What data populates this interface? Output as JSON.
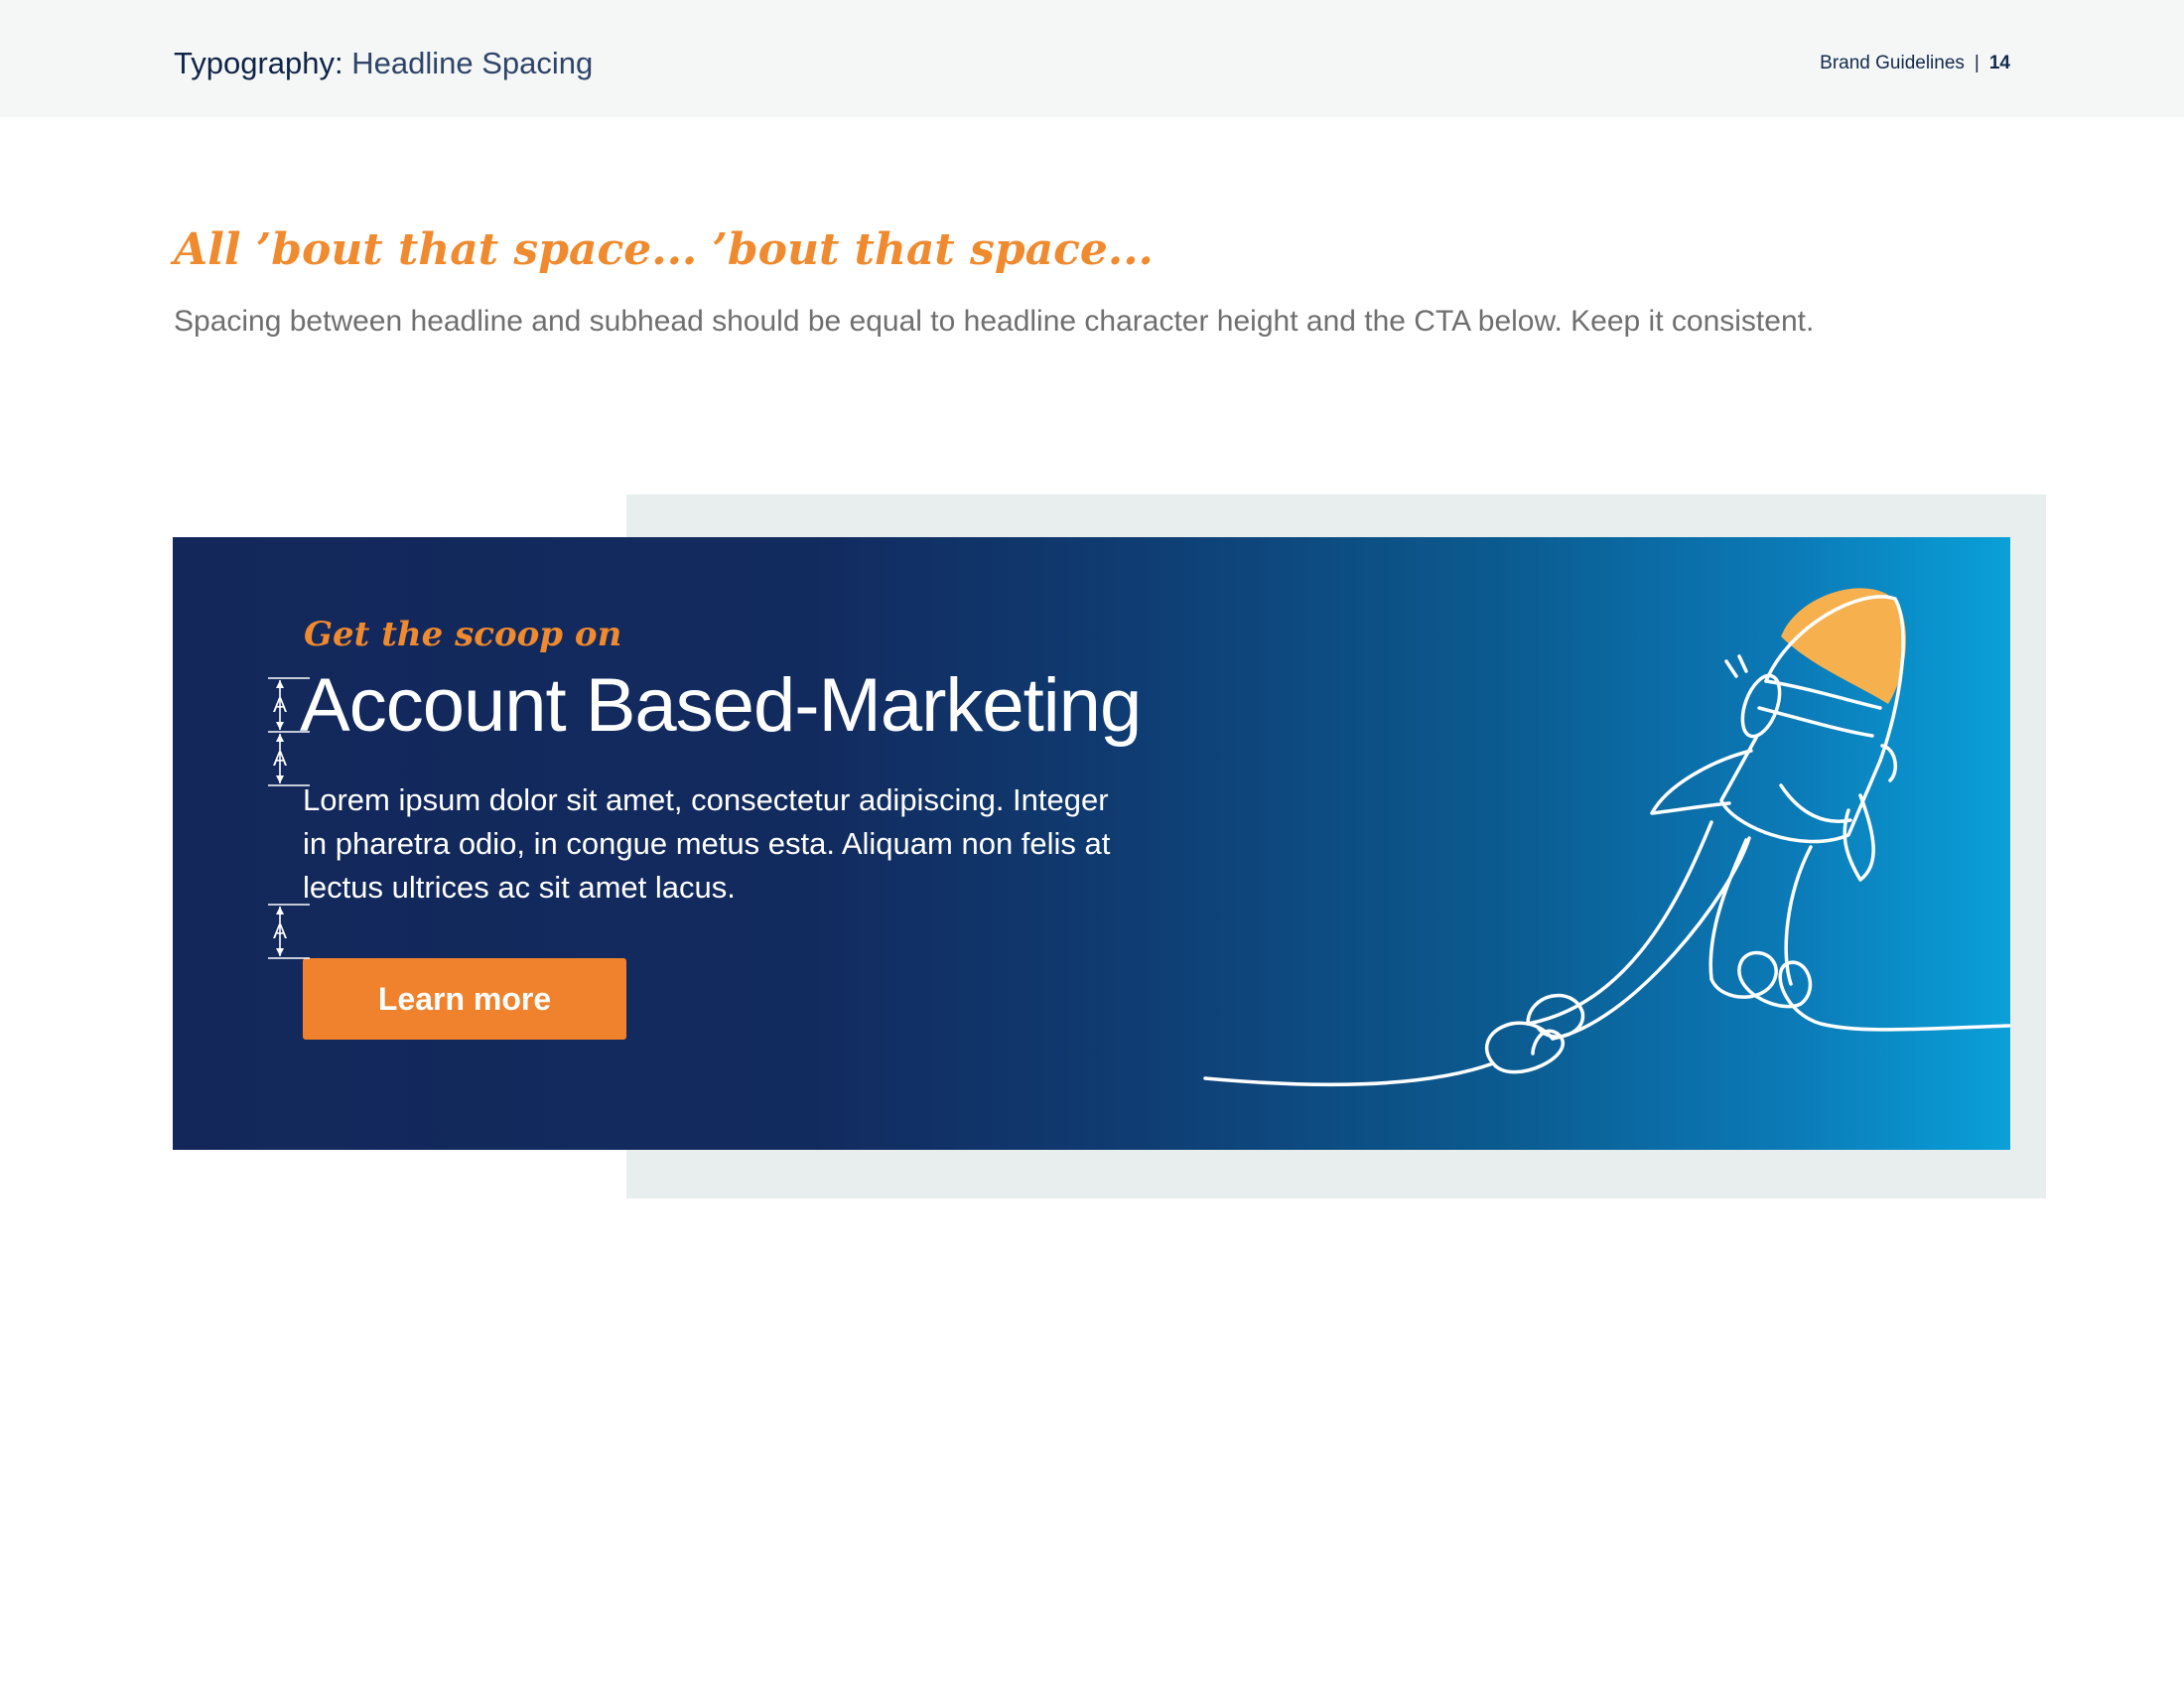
{
  "header": {
    "section": "Typography:",
    "subsection": "Headline Spacing",
    "doc_name": "Brand Guidelines",
    "separator": "|",
    "page_number": "14"
  },
  "content": {
    "tagline": "All ’bout that space... ’bout that space...",
    "intro": "Spacing between headline and subhead should be equal to headline character height and the CTA below. Keep it consistent."
  },
  "banner": {
    "kicker": "Get the scoop on",
    "headline": "Account Based-Marketing",
    "body_lines": [
      "Lorem ipsum dolor sit amet, consectetur adipiscing. Integer",
      "in pharetra odio, in congue metus esta. Aliquam non felis at",
      "lectus ultrices ac sit amet lacus."
    ],
    "cta_label": "Learn more",
    "guide_glyph": "A"
  },
  "colors": {
    "navy": "#13275a",
    "cyan": "#0aa0d8",
    "orange": "#f0822d",
    "rocket_tip": "#f6b14e",
    "backdrop": "#e8eded"
  }
}
